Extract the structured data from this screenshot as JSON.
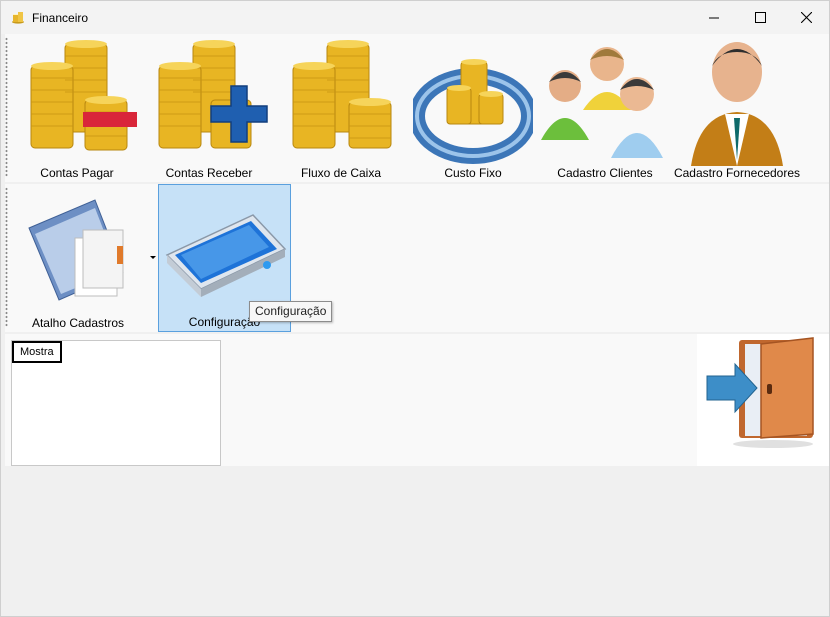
{
  "window": {
    "title": "Financeiro"
  },
  "toolbar_top": {
    "buttons": [
      {
        "label": "Contas Pagar",
        "icon": "coins-minus-icon"
      },
      {
        "label": "Contas Receber",
        "icon": "coins-plus-icon"
      },
      {
        "label": "Fluxo de Caixa",
        "icon": "coins-stack-icon"
      },
      {
        "label": "Custo Fixo",
        "icon": "coins-cycle-icon"
      },
      {
        "label": "Cadastro Clientes",
        "icon": "people-group-icon"
      },
      {
        "label": "Cadastro Fornecedores",
        "icon": "businessman-icon"
      }
    ]
  },
  "toolbar_bottom": {
    "buttons": [
      {
        "label": "Atalho Cadastros",
        "icon": "folder-documents-icon",
        "has_dropdown": true
      },
      {
        "label": "Configuração",
        "icon": "scanner-icon",
        "selected": true
      }
    ]
  },
  "tooltip": "Configuração",
  "panel": {
    "list_header": "Mostra",
    "exit_icon": "exit-door-icon"
  },
  "colors": {
    "selected_bg": "#c6e1f7",
    "selected_border": "#5aa0de",
    "coin_gold": "#e8b523",
    "minus_red": "#d9263a",
    "plus_blue": "#1f5fb0"
  }
}
